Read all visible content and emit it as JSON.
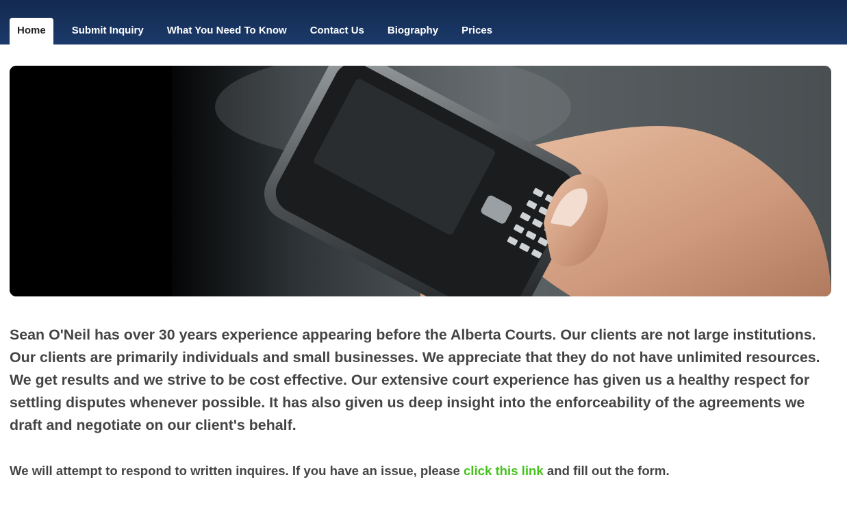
{
  "nav": {
    "tabs": [
      {
        "label": "Home",
        "active": true
      },
      {
        "label": "Submit Inquiry"
      },
      {
        "label": "What You Need To Know"
      },
      {
        "label": "Contact Us"
      },
      {
        "label": "Biography"
      },
      {
        "label": "Prices"
      }
    ]
  },
  "content": {
    "intro": "Sean O'Neil has over 30 years experience appearing before the Alberta Courts. Our clients are not large institutions. Our clients are primarily individuals and small businesses. We appreciate that they do not have unlimited resources. We get results and we strive to be cost effective. Our extensive court experience has given us a healthy respect for settling disputes whenever possible. It has also given us deep insight into the enforceability of the agreements we draft and negotiate on our client's behalf.",
    "notice_before": "We will attempt to respond to written inquires. If you have an issue, please ",
    "notice_link": "click this link",
    "notice_after": " and fill out the form."
  },
  "colors": {
    "nav_bg": "#1b3a6a",
    "link": "#44c21c",
    "text": "#444444"
  }
}
